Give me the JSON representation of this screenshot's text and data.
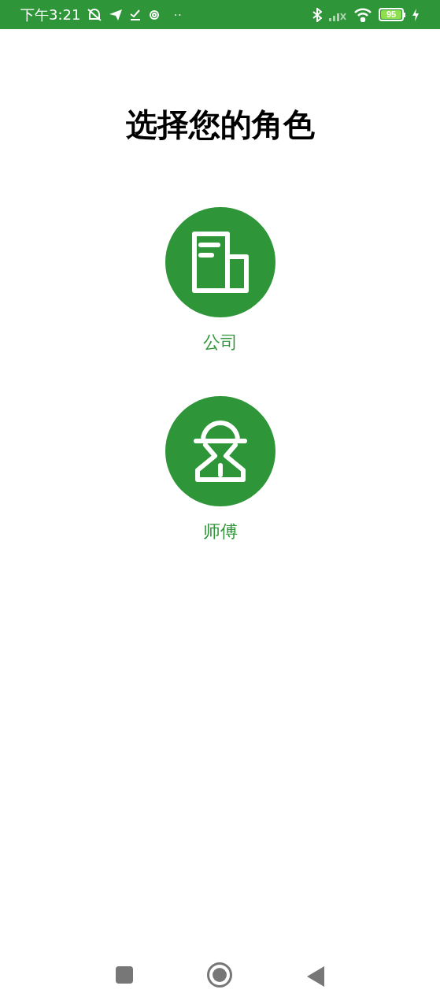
{
  "status_bar": {
    "time": "下午3:21",
    "more": "··",
    "battery": "95"
  },
  "title": "选择您的角色",
  "roles": [
    {
      "kind": "company",
      "label": "公司"
    },
    {
      "kind": "worker",
      "label": "师傅"
    }
  ]
}
